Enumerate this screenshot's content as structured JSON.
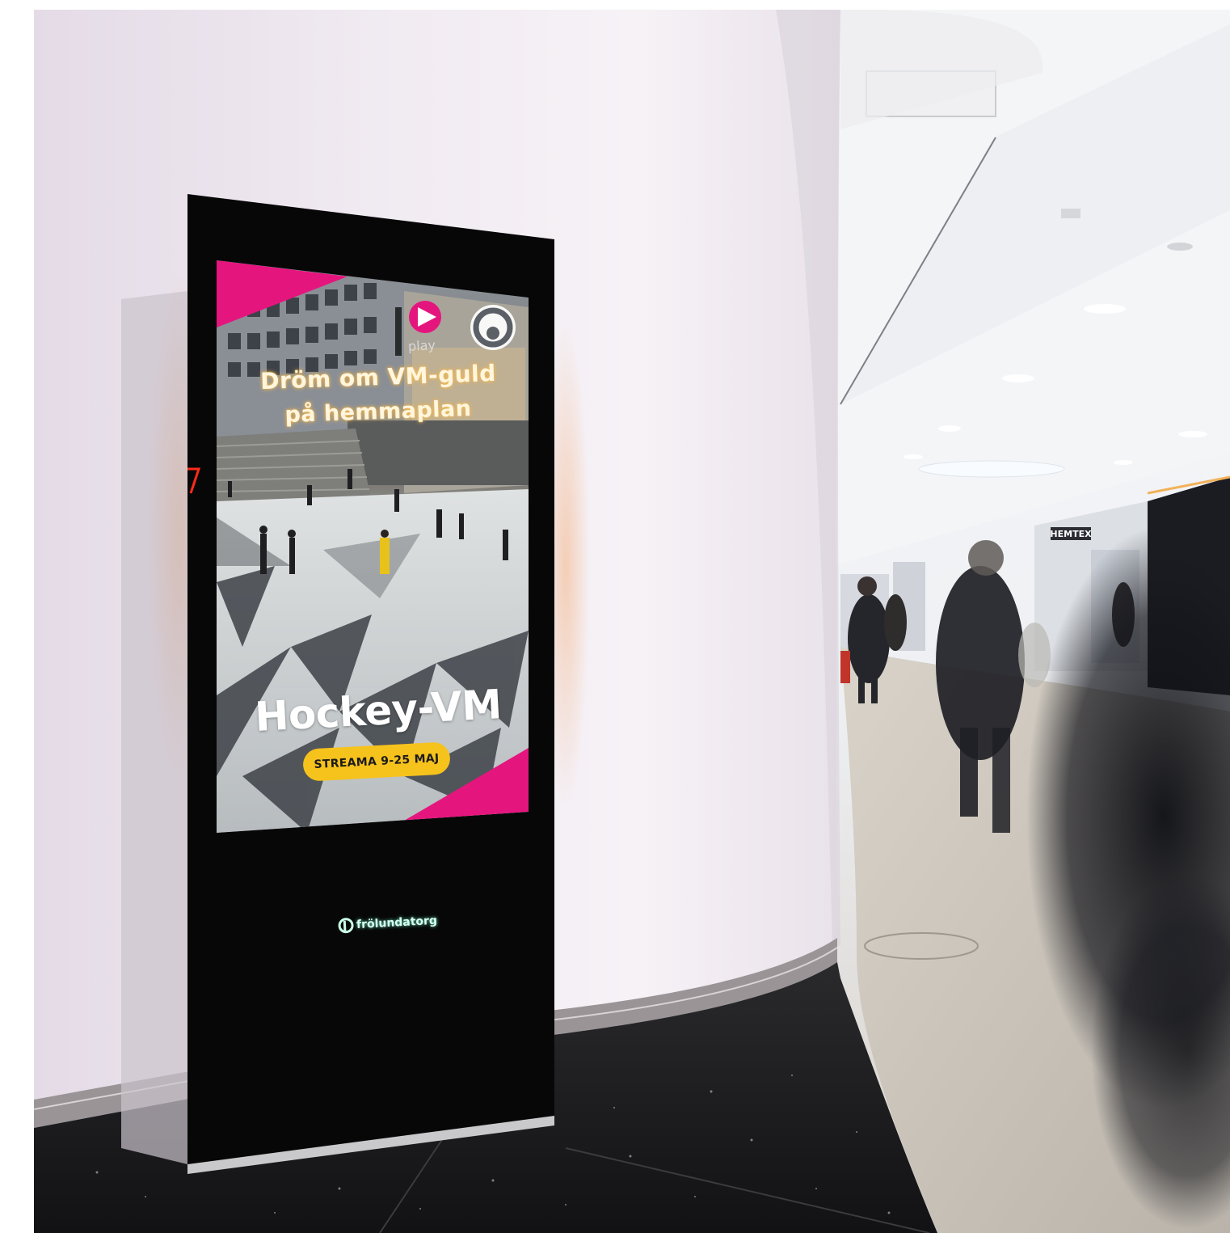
{
  "screen": {
    "headline_line1": "Dröm om VM-guld",
    "headline_line2": "på hemmaplan",
    "title": "Hockey-VM",
    "badge": "STREAMA 9-25 MAJ",
    "play_brand": "play"
  },
  "venue": {
    "logo_text": "frölundatorg"
  },
  "store_sign": "HEMTEX",
  "colors": {
    "accent_pink": "#e5157e",
    "badge_yellow": "#f6c21c",
    "wall": "#efe8f0",
    "totem": "#070707"
  }
}
